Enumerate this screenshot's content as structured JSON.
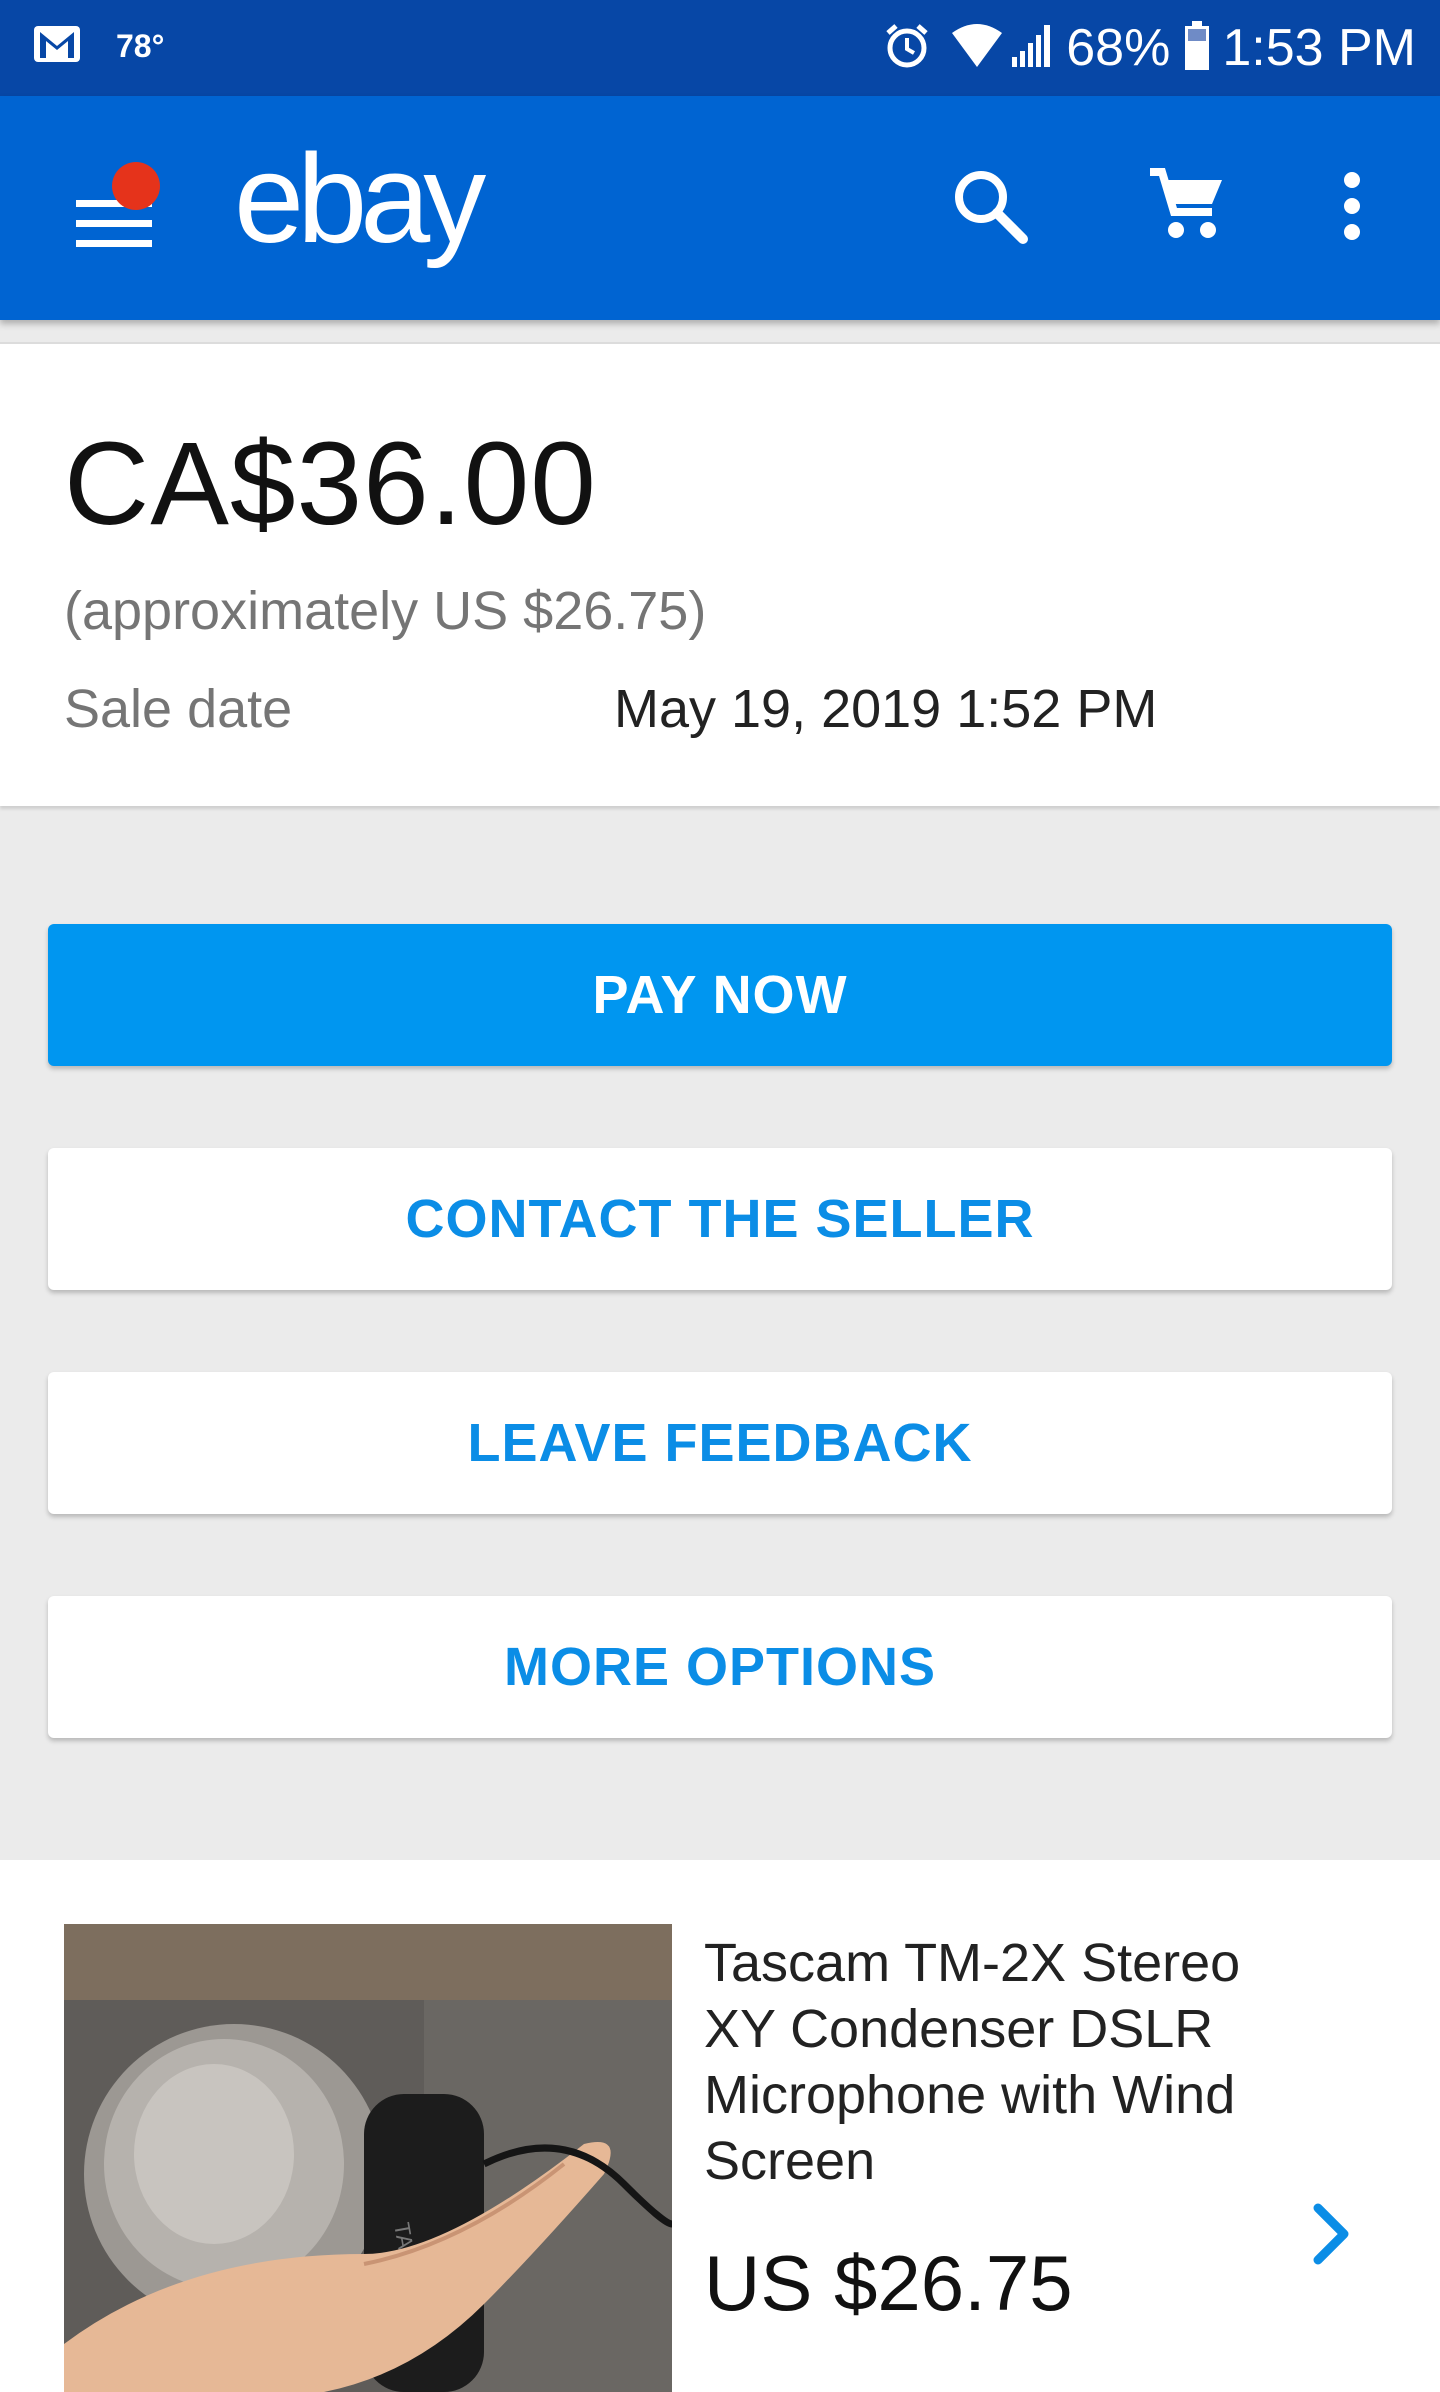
{
  "status_bar": {
    "temperature": "78°",
    "battery": "68%",
    "time": "1:53 PM"
  },
  "app_bar": {
    "logo": "ebay",
    "icons": [
      "menu-icon",
      "search-icon",
      "cart-icon",
      "more-vert-icon"
    ],
    "notification_dot_color": "#e5331b",
    "brand_color": "#0064d2"
  },
  "summary": {
    "price": "CA$36.00",
    "approx_price": "(approximately US $26.75)",
    "sale_date_label": "Sale date",
    "sale_date_value": "May 19, 2019 1:52 PM"
  },
  "actions": {
    "pay_now": "PAY NOW",
    "contact_seller": "CONTACT THE SELLER",
    "leave_feedback": "LEAVE FEEDBACK",
    "more_options": "MORE OPTIONS",
    "primary_color": "#0096f0"
  },
  "item": {
    "title": "Tascam TM-2X Stereo XY Condenser DSLR Microphone with Wind Screen",
    "price": "US $26.75",
    "image_text": "TASCAM"
  }
}
